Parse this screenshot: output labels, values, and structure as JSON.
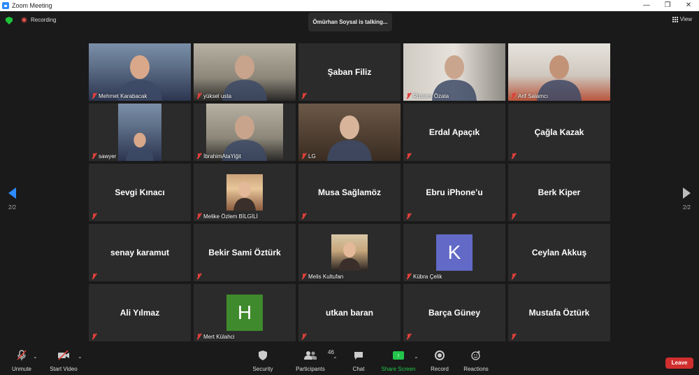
{
  "window": {
    "title": "Zoom Meeting",
    "controls": [
      "—",
      "❐",
      "✕"
    ]
  },
  "topbar": {
    "recording_label": "Recording",
    "talking_banner": "Ömürhan Soysal is talking...",
    "view_label": "View"
  },
  "nav": {
    "page_left": "2/2",
    "page_right": "2/2"
  },
  "tiles": [
    {
      "name": "Mehmet Karabacak",
      "video": true,
      "row": 0,
      "col": 0
    },
    {
      "name": "yüksel usta",
      "video": true,
      "row": 0,
      "col": 1
    },
    {
      "name": "Şaban Filiz",
      "video": false,
      "row": 0,
      "col": 2
    },
    {
      "name": "Rüstem Özata",
      "video": true,
      "row": 0,
      "col": 3
    },
    {
      "name": "Arif Salamcı",
      "video": true,
      "row": 0,
      "col": 4
    },
    {
      "name": "sawyer",
      "video": true,
      "row": 1,
      "col": 0
    },
    {
      "name": "İbrahimAtaYiğit",
      "video": true,
      "row": 1,
      "col": 1
    },
    {
      "name": "LG",
      "video": true,
      "row": 1,
      "col": 2
    },
    {
      "name": "Erdal Apaçık",
      "video": false,
      "row": 1,
      "col": 3
    },
    {
      "name": "Çağla Kazak",
      "video": false,
      "row": 1,
      "col": 4
    },
    {
      "name": "Sevgi Kınacı",
      "video": false,
      "row": 2,
      "col": 0
    },
    {
      "name": "Melike Özlem BİLGİLİ",
      "photo": true,
      "row": 2,
      "col": 1
    },
    {
      "name": "Musa Sağlamöz",
      "video": false,
      "row": 2,
      "col": 2
    },
    {
      "name": "Ebru iPhone’u",
      "video": false,
      "row": 2,
      "col": 3
    },
    {
      "name": "Berk Kiper",
      "video": false,
      "row": 2,
      "col": 4
    },
    {
      "name": "senay karamut",
      "video": false,
      "row": 3,
      "col": 0
    },
    {
      "name": "Bekir Sami Öztürk",
      "video": false,
      "row": 3,
      "col": 1
    },
    {
      "name": "Melis Kultufan",
      "photo": true,
      "row": 3,
      "col": 2
    },
    {
      "name": "Kübra Çelik",
      "avatar": "K",
      "avatar_color": "#6269c7",
      "row": 3,
      "col": 3
    },
    {
      "name": "Ceylan Akkuş",
      "video": false,
      "row": 3,
      "col": 4
    },
    {
      "name": "Ali Yılmaz",
      "video": false,
      "row": 4,
      "col": 0
    },
    {
      "name": "Mert Külahci",
      "avatar": "H",
      "avatar_color": "#3f8a2c",
      "row": 4,
      "col": 1
    },
    {
      "name": "utkan baran",
      "video": false,
      "row": 4,
      "col": 2
    },
    {
      "name": "Barça Güney",
      "video": false,
      "row": 4,
      "col": 3
    },
    {
      "name": "Mustafa Öztürk",
      "video": false,
      "row": 4,
      "col": 4
    }
  ],
  "toolbar": {
    "unmute": "Unmute",
    "start_video": "Start Video",
    "security": "Security",
    "participants": "Participants",
    "participants_count": "46",
    "chat": "Chat",
    "share_screen": "Share Screen",
    "record": "Record",
    "reactions": "Reactions",
    "leave": "Leave"
  },
  "colors": {
    "accent": "#2d8cff",
    "share_green": "#22c64c",
    "leave_red": "#d12e2e",
    "mute_red": "#e0403a"
  }
}
